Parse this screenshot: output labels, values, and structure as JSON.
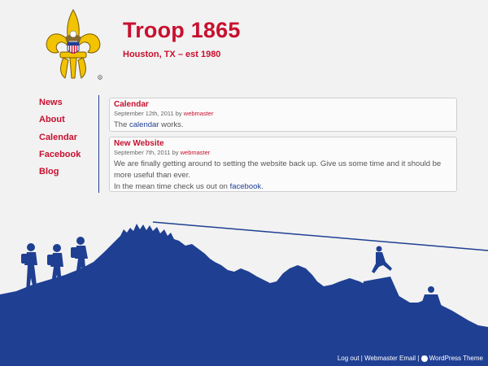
{
  "site": {
    "title": "Troop 1865",
    "tagline": "Houston, TX – est 1980"
  },
  "nav": {
    "items": [
      {
        "label": "News"
      },
      {
        "label": "About"
      },
      {
        "label": "Calendar"
      },
      {
        "label": "Facebook"
      },
      {
        "label": "Blog"
      }
    ]
  },
  "posts": [
    {
      "title": "Calendar",
      "date": "September 12th, 2011",
      "by": "by",
      "author": "webmaster",
      "body_prefix": "The ",
      "body_link": "calendar",
      "body_suffix": " works."
    },
    {
      "title": "New Website",
      "date": "September 7th, 2011",
      "by": "by",
      "author": "webmaster",
      "body_line1": "We are finally getting around to setting the website back up. Give us some time and it should be more useful than ever.",
      "body_line2_prefix": "In the mean time check us out on ",
      "body_line2_link": "facebook",
      "body_line2_suffix": "."
    }
  ],
  "footer": {
    "logout": "Log out",
    "sep1": " | ",
    "email": "Webmaster Email",
    "sep2": " | ",
    "theme": "WordPress Theme"
  },
  "colors": {
    "brand_red": "#c8102e",
    "brand_blue": "#1f3f93",
    "background": "#f2f2f2"
  },
  "icons": {
    "logo": "fleur-de-lis-scout-emblem",
    "footer": "wordpress-icon"
  }
}
